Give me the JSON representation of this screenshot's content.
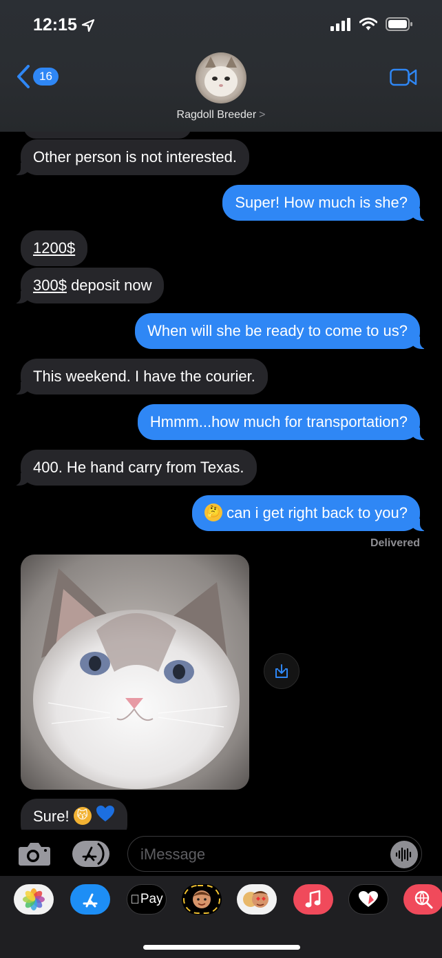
{
  "status_bar": {
    "time": "12:15"
  },
  "header": {
    "back_badge": "16",
    "contact_name": "Ragdoll Breeder",
    "chevron": ">"
  },
  "messages": [
    {
      "dir": "in",
      "text": "Other person is not interested."
    },
    {
      "dir": "out",
      "text": "Super! How much is she?"
    },
    {
      "dir": "in",
      "text": "1200$"
    },
    {
      "dir": "in",
      "link": "300$",
      "text": " deposit now"
    },
    {
      "dir": "out",
      "text": "When will she be ready to come to us?"
    },
    {
      "dir": "in",
      "text": "This weekend. I have the courier."
    },
    {
      "dir": "out",
      "text": "Hmmm...how much for transportation?"
    },
    {
      "dir": "in",
      "text": "400. He hand carry from Texas."
    },
    {
      "dir": "out",
      "emoji": "thinking-face",
      "text": "can i get right back to you?"
    },
    {
      "dir": "in",
      "text": "Sure!",
      "emojis": [
        "kissing-cat",
        "blue-heart"
      ]
    }
  ],
  "delivered_label": "Delivered",
  "input": {
    "placeholder": "iMessage"
  },
  "tray": [
    "Photos",
    "App Store",
    "Apple Pay",
    "Memoji",
    "Memoji Stickers",
    "Music",
    "Heart",
    "Search"
  ],
  "tray_labels": {
    "apple_pay": "Pay"
  },
  "colors": {
    "outgoing": "#2f87f5",
    "incoming": "#26262a",
    "background": "#000000"
  }
}
